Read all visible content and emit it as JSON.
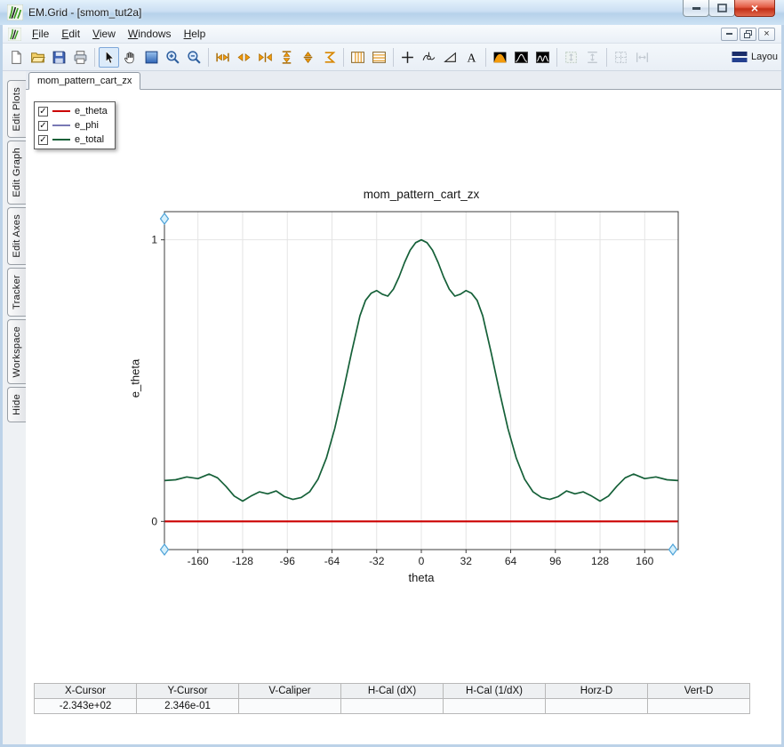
{
  "window": {
    "title": "EM.Grid - [smom_tut2a]"
  },
  "menu": {
    "items": [
      "File",
      "Edit",
      "View",
      "Windows",
      "Help"
    ]
  },
  "toolbar": {
    "layout_label": "Layou",
    "buttons": [
      "new-document",
      "open-file",
      "save",
      "print",
      "select-cursor",
      "pan-hand",
      "zoom-window",
      "zoom-in",
      "zoom-out",
      "expand-x",
      "arrows-out-x",
      "arrows-in-x",
      "expand-y",
      "arrows-updown",
      "sum",
      "panes-vertical",
      "panes-horizontal",
      "crosshair",
      "tracker",
      "slope-triangle",
      "text-label",
      "gradient-plot",
      "waveform-1",
      "waveform-2",
      "fit-box-disabled",
      "fit-vertical-disabled",
      "snap-grid-disabled",
      "fit-horizontal-disabled",
      "layout"
    ],
    "selected_button": "select-cursor"
  },
  "sidebar": {
    "tabs": [
      "Edit Plots",
      "Edit Graph",
      "Edit Axes",
      "Tracker",
      "Workspace",
      "Hide"
    ]
  },
  "document_tab": {
    "label": "mom_pattern_cart_zx"
  },
  "legend": {
    "items": [
      {
        "label": "e_theta",
        "color": "#cc0000",
        "checked": true
      },
      {
        "label": "e_phi",
        "color": "#7878b4",
        "checked": true
      },
      {
        "label": "e_total",
        "color": "#156038",
        "checked": true
      }
    ]
  },
  "chart_data": {
    "type": "line",
    "title": "mom_pattern_cart_zx",
    "xlabel": "theta",
    "ylabel": "e_theta",
    "xlim": [
      -184,
      184
    ],
    "ylim": [
      -0.1,
      1.1
    ],
    "xticks": [
      -160,
      -128,
      -96,
      -64,
      -32,
      0,
      32,
      64,
      96,
      128,
      160
    ],
    "yticks": [
      0,
      1
    ],
    "grid": true,
    "legend_position": "top-left-floating",
    "x": [
      -184,
      -176,
      -168,
      -160,
      -152,
      -146,
      -140,
      -134,
      -128,
      -122,
      -116,
      -110,
      -104,
      -98,
      -92,
      -86,
      -80,
      -74,
      -68,
      -62,
      -56,
      -50,
      -44,
      -40,
      -36,
      -32,
      -28,
      -24,
      -20,
      -16,
      -12,
      -8,
      -4,
      0,
      4,
      8,
      12,
      16,
      20,
      24,
      28,
      32,
      36,
      40,
      44,
      50,
      56,
      62,
      68,
      74,
      80,
      86,
      92,
      98,
      104,
      110,
      116,
      122,
      128,
      134,
      140,
      146,
      152,
      160,
      168,
      176,
      184
    ],
    "series": [
      {
        "name": "e_theta",
        "color": "#cc0000",
        "values": [
          0,
          0,
          0,
          0,
          0,
          0,
          0,
          0,
          0,
          0,
          0,
          0,
          0,
          0,
          0,
          0,
          0,
          0,
          0,
          0,
          0,
          0,
          0,
          0,
          0,
          0,
          0,
          0,
          0,
          0,
          0,
          0,
          0,
          0,
          0,
          0,
          0,
          0,
          0,
          0,
          0,
          0,
          0,
          0,
          0,
          0,
          0,
          0,
          0,
          0,
          0,
          0,
          0,
          0,
          0,
          0,
          0,
          0,
          0,
          0,
          0,
          0,
          0,
          0,
          0,
          0,
          0
        ]
      },
      {
        "name": "e_phi",
        "color": "#7878b4",
        "values": []
      },
      {
        "name": "e_total",
        "color": "#156038",
        "values": [
          0.145,
          0.148,
          0.158,
          0.152,
          0.168,
          0.155,
          0.125,
          0.09,
          0.072,
          0.09,
          0.105,
          0.098,
          0.108,
          0.088,
          0.078,
          0.085,
          0.105,
          0.15,
          0.225,
          0.33,
          0.46,
          0.6,
          0.73,
          0.785,
          0.81,
          0.82,
          0.807,
          0.8,
          0.825,
          0.868,
          0.92,
          0.963,
          0.99,
          1.0,
          0.99,
          0.963,
          0.92,
          0.868,
          0.825,
          0.8,
          0.807,
          0.82,
          0.81,
          0.785,
          0.73,
          0.6,
          0.46,
          0.33,
          0.225,
          0.15,
          0.105,
          0.085,
          0.078,
          0.088,
          0.108,
          0.098,
          0.105,
          0.09,
          0.072,
          0.09,
          0.125,
          0.155,
          0.168,
          0.152,
          0.158,
          0.148,
          0.145
        ]
      }
    ]
  },
  "status_table": {
    "headers": [
      "X-Cursor",
      "Y-Cursor",
      "V-Caliper",
      "H-Cal (dX)",
      "H-Cal (1/dX)",
      "Horz-D",
      "Vert-D"
    ],
    "values": [
      "-2.343e+02",
      "2.346e-01",
      "",
      "",
      "",
      "",
      ""
    ]
  }
}
